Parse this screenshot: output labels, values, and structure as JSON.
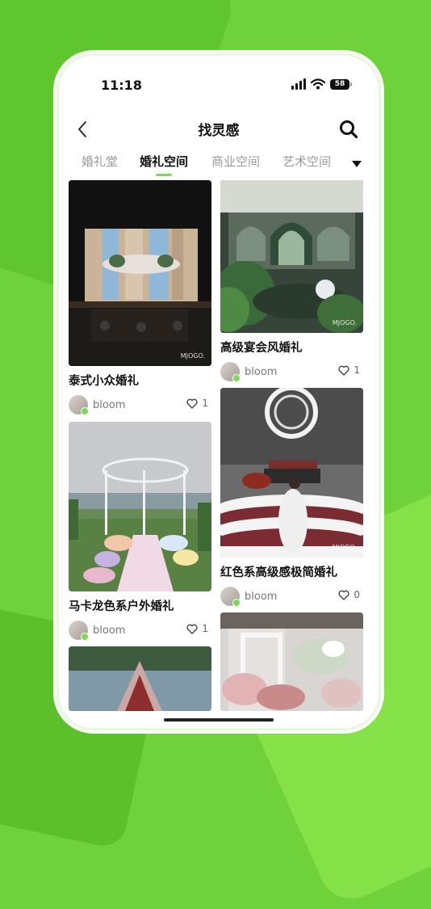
{
  "status_bar": {
    "time": "11:18",
    "battery": "58"
  },
  "header": {
    "title": "找灵感"
  },
  "tabs": [
    {
      "label": "婚礼堂",
      "active": false
    },
    {
      "label": "婚礼空间",
      "active": true
    },
    {
      "label": "商业空间",
      "active": false
    },
    {
      "label": "艺术空间",
      "active": false
    }
  ],
  "cards": [
    {
      "title": "泰式小众婚礼",
      "author": "bloom",
      "likes": "1",
      "watermark": "MJOGO."
    },
    {
      "title": "高级宴会风婚礼",
      "author": "bloom",
      "likes": "1",
      "watermark": "MJOGO."
    },
    {
      "title": "马卡龙色系户外婚礼",
      "author": "bloom",
      "likes": "1"
    },
    {
      "title": "红色系高级感极简婚礼",
      "author": "bloom",
      "likes": "0",
      "watermark": "MJOGO."
    },
    {
      "title": "",
      "author": "",
      "likes": ""
    },
    {
      "title": "",
      "author": "",
      "likes": ""
    }
  ],
  "colors": {
    "accent": "#7ed957",
    "background": "#6fd23a"
  }
}
